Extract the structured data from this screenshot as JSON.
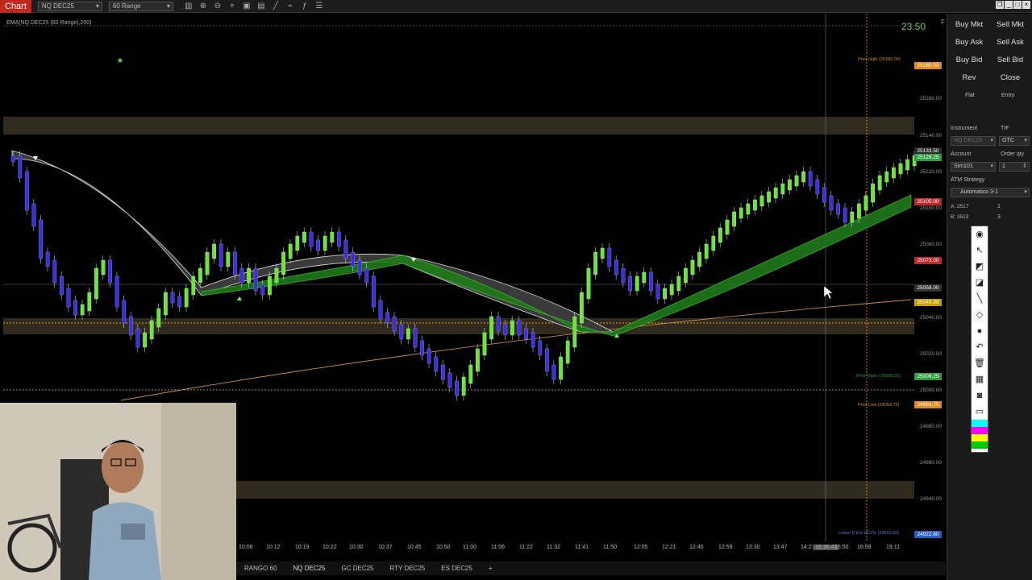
{
  "topbar": {
    "chart_tab": "Chart",
    "instrument_select": "NQ DEC25",
    "bar_type_select": "60 Range",
    "toolbar_icons": [
      "bar-type-icon",
      "zoom-in-icon",
      "zoom-out-icon",
      "crosshair-icon",
      "properties-icon",
      "templates-icon",
      "drawing-tools-icon",
      "strategies-icon",
      "indicators-icon",
      "data-box-icon"
    ],
    "window_controls": [
      "restore-icon",
      "minimize-icon",
      "maximize-icon",
      "close-icon"
    ]
  },
  "chart": {
    "indicator_label": "EMA(NQ DEC25 (60 Range),200)",
    "last_price_big": "23.50",
    "f_button": "F",
    "axis_tags": [
      {
        "text": "25180.00",
        "color": "#e08a1e"
      },
      {
        "text": "25133.50",
        "color": "#2a2a2a"
      },
      {
        "text": "25129.25",
        "color": "#2e9e3e"
      },
      {
        "text": "25105.00",
        "color": "#c0262a"
      },
      {
        "text": "25073.00",
        "color": "#c0262a"
      },
      {
        "text": "25058.00",
        "color": "#333333"
      },
      {
        "text": "25049.98",
        "color": "#c6a100"
      },
      {
        "text": "25009.25",
        "color": "#2e9e3e"
      },
      {
        "text": "24993.75",
        "color": "#e08a1e"
      },
      {
        "text": "24922.60",
        "color": "#2a5fbf"
      }
    ],
    "axis_ticks": [
      "25160.00",
      "25140.00",
      "25120.00",
      "25100.00",
      "25080.00",
      "25060.00",
      "25040.00",
      "25020.00",
      "25000.00",
      "24980.00",
      "24960.00",
      "24940.00"
    ],
    "level_labels": {
      "prior_high": "Prior High (25180.00)",
      "prior_low": "Prior Low (24993.75)",
      "prior_open": "Prior Open (25009.25)",
      "lower_d_ext": "Lower D Ext 22.2% (24922.60)"
    },
    "time_axis": [
      "10:06",
      "10:12",
      "10:19",
      "10:22",
      "10:30",
      "10:37",
      "10:45",
      "10:50",
      "11:00",
      "11:06",
      "11:22",
      "11:32",
      "11:41",
      "11:50",
      "12:05",
      "12:21",
      "12:40",
      "12:59",
      "13:30",
      "13:47",
      "14:27",
      "15:36:47",
      "16:50",
      "16:59",
      "19:11"
    ],
    "colors": {
      "up": "#6fe33c",
      "down": "#3b2fd6",
      "ema_band": "#3fbf2a",
      "level_line": "#e2a31b"
    }
  },
  "bottom_tabs": [
    "RANGO 60",
    "NQ DEC25",
    "GC DEC25",
    "RTY DEC25",
    "ES DEC25"
  ],
  "add_tab_icon": "plus-icon",
  "order_panel": {
    "buttons": [
      [
        "Buy Mkt",
        "Sell Mkt"
      ],
      [
        "Buy Ask",
        "Sell Ask"
      ],
      [
        "Buy Bid",
        "Sell Bid"
      ],
      [
        "Rev",
        "Close"
      ]
    ],
    "flat": "Flat",
    "entry": "Entry",
    "instrument_label": "Instrument",
    "tif_label": "TIF",
    "instrument_value": "NQ DEC25",
    "tif_value": "GTC",
    "account_label": "Account",
    "order_qty_label": "Order qty",
    "account_value": "Sim101",
    "order_qty_value": "1",
    "atm_label": "ATM Strategy",
    "atm_value": "Automatico 3-1",
    "ask_label": "A: 2517",
    "bid_label": "B: 2513",
    "pos_a": "1",
    "pos_b": "3"
  },
  "drawing_tools": [
    "eye-icon",
    "cursor-icon",
    "ruler-icon",
    "ruler-icon-2",
    "line-icon",
    "eraser-icon",
    "dot-icon",
    "undo-icon",
    "trash-icon",
    "stamp-icon",
    "camera-icon",
    "clipboard-icon"
  ],
  "swatches": [
    "#00ffff",
    "#ff00ff",
    "#ffff00",
    "#00cc00"
  ]
}
